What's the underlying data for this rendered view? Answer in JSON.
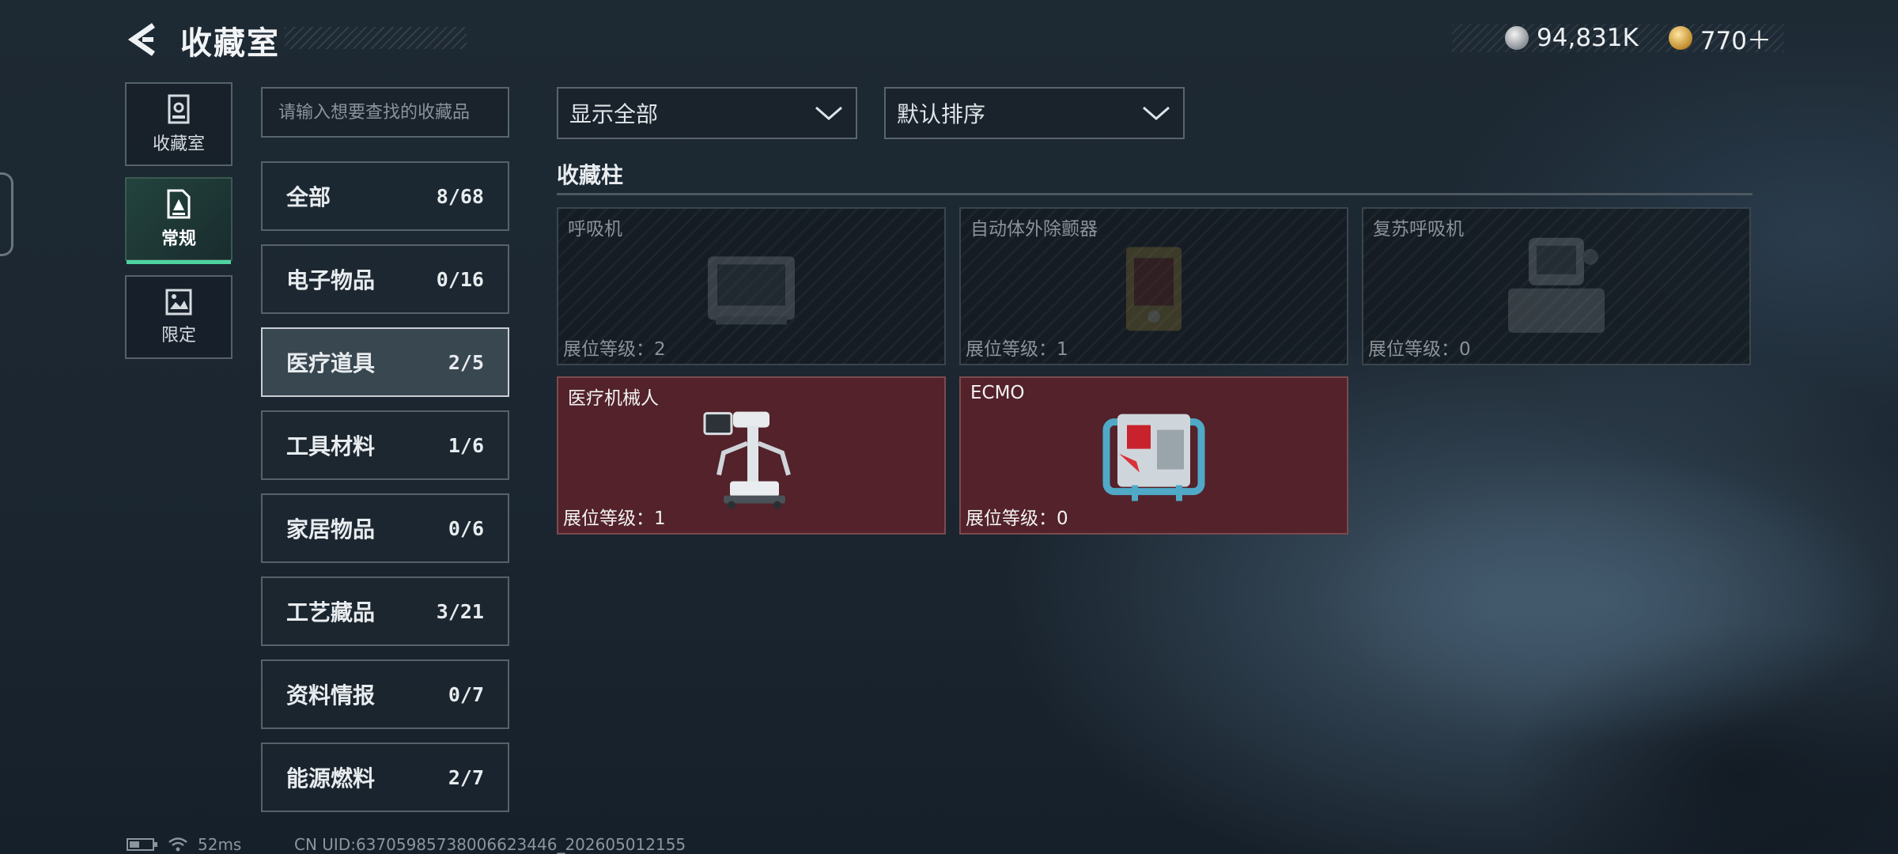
{
  "header": {
    "title": "收藏室",
    "currency": [
      {
        "icon": "silver-coin-icon",
        "value": "94,831K"
      },
      {
        "icon": "gold-coin-icon",
        "value": "770＋"
      }
    ]
  },
  "side_nav": [
    {
      "label": "收藏室",
      "icon": "archive-icon",
      "active": false
    },
    {
      "label": "常规",
      "icon": "document-icon",
      "active": true
    },
    {
      "label": "限定",
      "icon": "picture-icon",
      "active": false
    }
  ],
  "search": {
    "placeholder": "请输入想要查找的收藏品"
  },
  "categories": [
    {
      "name": "全部",
      "count": "8/68"
    },
    {
      "name": "电子物品",
      "count": "0/16"
    },
    {
      "name": "医疗道具",
      "count": "2/5",
      "selected": true
    },
    {
      "name": "工具材料",
      "count": "1/6"
    },
    {
      "name": "家居物品",
      "count": "0/6"
    },
    {
      "name": "工艺藏品",
      "count": "3/21"
    },
    {
      "name": "资料情报",
      "count": "0/7"
    },
    {
      "name": "能源燃料",
      "count": "2/7"
    }
  ],
  "filters": {
    "show": "显示全部",
    "sort": "默认排序"
  },
  "cabinet": {
    "title": "收藏柱",
    "level_prefix": "展位等级：",
    "items": [
      {
        "name": "呼吸机",
        "level": "展位等级：2",
        "owned": false,
        "icon": "ventilator-icon"
      },
      {
        "name": "自动体外除颤器",
        "level": "展位等级：1",
        "owned": false,
        "icon": "defibrillator-icon"
      },
      {
        "name": "复苏呼吸机",
        "level": "展位等级：0",
        "owned": false,
        "icon": "resuscitator-icon"
      },
      {
        "name": "医疗机械人",
        "level": "展位等级：1",
        "owned": true,
        "icon": "medical-robot-icon"
      },
      {
        "name": "ECMO",
        "level": "展位等级：0",
        "owned": true,
        "icon": "ecmo-machine-icon"
      }
    ]
  },
  "status": {
    "ping": "52ms",
    "uid": "CN UID:63705985738006623446_202605012155"
  },
  "colors": {
    "accent": "#4ed3a0",
    "owned_card": "#53222a",
    "background": "#1b2630"
  }
}
